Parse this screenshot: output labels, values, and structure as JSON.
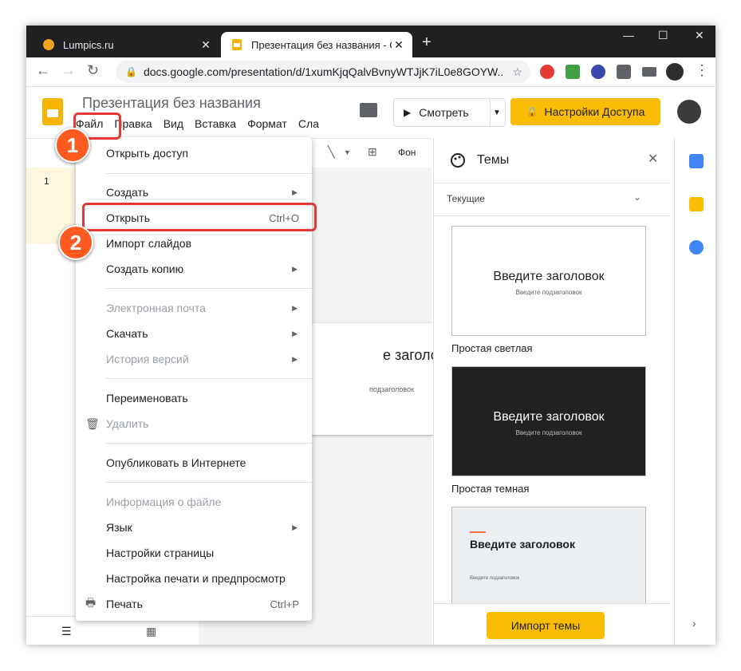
{
  "browser": {
    "tabs": [
      {
        "title": "Lumpics.ru"
      },
      {
        "title": "Презентация без названия - Go"
      }
    ],
    "url": "docs.google.com/presentation/d/1xumKjqQalvBvnyWTJjK7iL0e8GOYW..."
  },
  "docs": {
    "title": "Презентация без названия",
    "menu": [
      "Файл",
      "Правка",
      "Вид",
      "Вставка",
      "Формат",
      "Сла"
    ],
    "present_label": "Смотреть",
    "share_label": "Настройки Доступа",
    "toolbar_bg": "Фон"
  },
  "slide": {
    "number": "1",
    "title_fragment": "е заголовок",
    "subtitle_fragment": "подзаголовок"
  },
  "themes": {
    "title": "Темы",
    "current_label": "Текущие",
    "items": [
      {
        "name": "Простая светлая",
        "title": "Введите заголовок",
        "subtitle": "Введите подзаголовок"
      },
      {
        "name": "Простая темная",
        "title": "Введите заголовок",
        "subtitle": "Введите подзаголовок"
      },
      {
        "title": "Введите заголовок",
        "subtitle": "Введите подзаголовок"
      }
    ],
    "import_label": "Импорт темы"
  },
  "file_menu": {
    "items": [
      {
        "label": "Открыть доступ"
      },
      {
        "label": "Создать"
      },
      {
        "label": "Открыть",
        "shortcut": "Ctrl+O"
      },
      {
        "label": "Импорт слайдов"
      },
      {
        "label": "Создать копию"
      },
      {
        "label": "Электронная почта"
      },
      {
        "label": "Скачать"
      },
      {
        "label": "История версий"
      },
      {
        "label": "Переименовать"
      },
      {
        "label": "Удалить"
      },
      {
        "label": "Опубликовать в Интернете"
      },
      {
        "label": "Информация о файле"
      },
      {
        "label": "Язык"
      },
      {
        "label": "Настройки страницы"
      },
      {
        "label": "Настройка печати и предпросмотр"
      },
      {
        "label": "Печать",
        "shortcut": "Ctrl+P"
      }
    ]
  },
  "annotations": {
    "step1": "1",
    "step2": "2"
  },
  "colors": {
    "accent": "#fbbc04",
    "highlight": "#e53935",
    "badge": "#ff5a1f"
  }
}
